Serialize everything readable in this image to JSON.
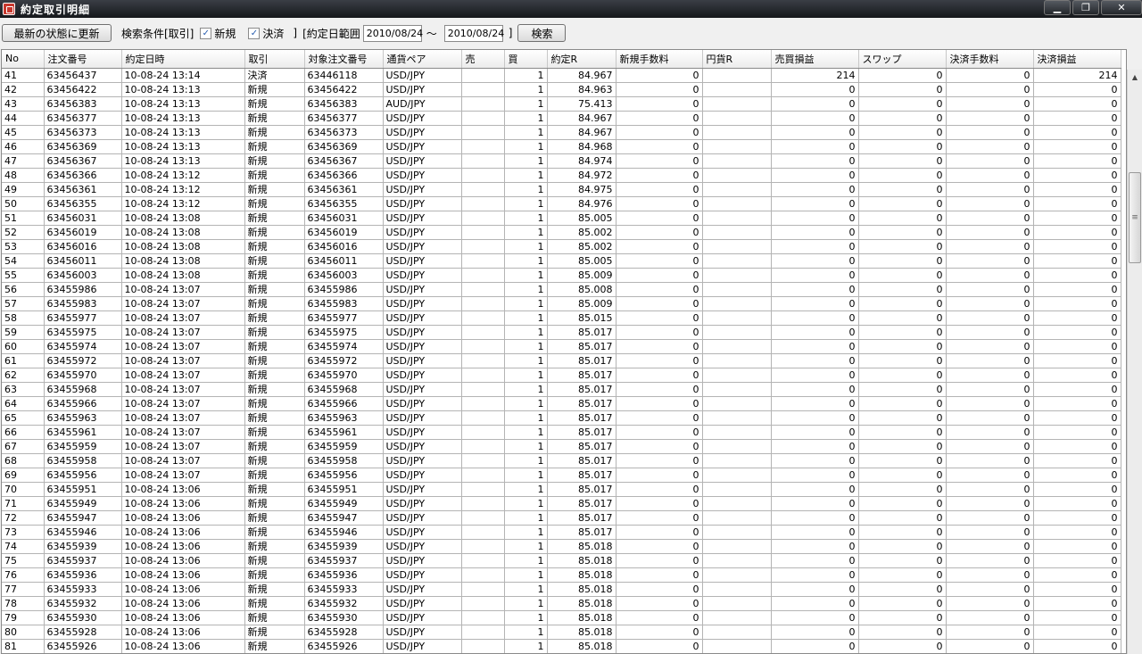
{
  "window": {
    "title": "約定取引明細",
    "min": "▁",
    "max": "❐",
    "close": "✕"
  },
  "toolbar": {
    "refresh_label": "最新の状態に更新",
    "criteria_label": "検索条件[取引]",
    "new_label": "新規",
    "new_checked": "✓",
    "settle_label": "決済",
    "settle_checked": "✓",
    "close_bracket": "]",
    "date_range_label": "[約定日範囲",
    "date_from": "2010/08/24",
    "tilde": "～",
    "date_to": "2010/08/24",
    "date_close": "]",
    "search_label": "検索"
  },
  "grid": {
    "columns": [
      "No",
      "注文番号",
      "約定日時",
      "取引",
      "対象注文番号",
      "通貨ペア",
      "売",
      "買",
      "約定R",
      "新規手数料",
      "円貨R",
      "売買損益",
      "スワップ",
      "決済手数料",
      "決済損益"
    ],
    "rows": [
      [
        "41",
        "63456437",
        "10-08-24 13:14",
        "決済",
        "63446118",
        "USD/JPY",
        "",
        "1",
        "84.967",
        "0",
        "",
        "214",
        "0",
        "0",
        "214"
      ],
      [
        "42",
        "63456422",
        "10-08-24 13:13",
        "新規",
        "63456422",
        "USD/JPY",
        "",
        "1",
        "84.963",
        "0",
        "",
        "0",
        "0",
        "0",
        "0"
      ],
      [
        "43",
        "63456383",
        "10-08-24 13:13",
        "新規",
        "63456383",
        "AUD/JPY",
        "",
        "1",
        "75.413",
        "0",
        "",
        "0",
        "0",
        "0",
        "0"
      ],
      [
        "44",
        "63456377",
        "10-08-24 13:13",
        "新規",
        "63456377",
        "USD/JPY",
        "",
        "1",
        "84.967",
        "0",
        "",
        "0",
        "0",
        "0",
        "0"
      ],
      [
        "45",
        "63456373",
        "10-08-24 13:13",
        "新規",
        "63456373",
        "USD/JPY",
        "",
        "1",
        "84.967",
        "0",
        "",
        "0",
        "0",
        "0",
        "0"
      ],
      [
        "46",
        "63456369",
        "10-08-24 13:13",
        "新規",
        "63456369",
        "USD/JPY",
        "",
        "1",
        "84.968",
        "0",
        "",
        "0",
        "0",
        "0",
        "0"
      ],
      [
        "47",
        "63456367",
        "10-08-24 13:13",
        "新規",
        "63456367",
        "USD/JPY",
        "",
        "1",
        "84.974",
        "0",
        "",
        "0",
        "0",
        "0",
        "0"
      ],
      [
        "48",
        "63456366",
        "10-08-24 13:12",
        "新規",
        "63456366",
        "USD/JPY",
        "",
        "1",
        "84.972",
        "0",
        "",
        "0",
        "0",
        "0",
        "0"
      ],
      [
        "49",
        "63456361",
        "10-08-24 13:12",
        "新規",
        "63456361",
        "USD/JPY",
        "",
        "1",
        "84.975",
        "0",
        "",
        "0",
        "0",
        "0",
        "0"
      ],
      [
        "50",
        "63456355",
        "10-08-24 13:12",
        "新規",
        "63456355",
        "USD/JPY",
        "",
        "1",
        "84.976",
        "0",
        "",
        "0",
        "0",
        "0",
        "0"
      ],
      [
        "51",
        "63456031",
        "10-08-24 13:08",
        "新規",
        "63456031",
        "USD/JPY",
        "",
        "1",
        "85.005",
        "0",
        "",
        "0",
        "0",
        "0",
        "0"
      ],
      [
        "52",
        "63456019",
        "10-08-24 13:08",
        "新規",
        "63456019",
        "USD/JPY",
        "",
        "1",
        "85.002",
        "0",
        "",
        "0",
        "0",
        "0",
        "0"
      ],
      [
        "53",
        "63456016",
        "10-08-24 13:08",
        "新規",
        "63456016",
        "USD/JPY",
        "",
        "1",
        "85.002",
        "0",
        "",
        "0",
        "0",
        "0",
        "0"
      ],
      [
        "54",
        "63456011",
        "10-08-24 13:08",
        "新規",
        "63456011",
        "USD/JPY",
        "",
        "1",
        "85.005",
        "0",
        "",
        "0",
        "0",
        "0",
        "0"
      ],
      [
        "55",
        "63456003",
        "10-08-24 13:08",
        "新規",
        "63456003",
        "USD/JPY",
        "",
        "1",
        "85.009",
        "0",
        "",
        "0",
        "0",
        "0",
        "0"
      ],
      [
        "56",
        "63455986",
        "10-08-24 13:07",
        "新規",
        "63455986",
        "USD/JPY",
        "",
        "1",
        "85.008",
        "0",
        "",
        "0",
        "0",
        "0",
        "0"
      ],
      [
        "57",
        "63455983",
        "10-08-24 13:07",
        "新規",
        "63455983",
        "USD/JPY",
        "",
        "1",
        "85.009",
        "0",
        "",
        "0",
        "0",
        "0",
        "0"
      ],
      [
        "58",
        "63455977",
        "10-08-24 13:07",
        "新規",
        "63455977",
        "USD/JPY",
        "",
        "1",
        "85.015",
        "0",
        "",
        "0",
        "0",
        "0",
        "0"
      ],
      [
        "59",
        "63455975",
        "10-08-24 13:07",
        "新規",
        "63455975",
        "USD/JPY",
        "",
        "1",
        "85.017",
        "0",
        "",
        "0",
        "0",
        "0",
        "0"
      ],
      [
        "60",
        "63455974",
        "10-08-24 13:07",
        "新規",
        "63455974",
        "USD/JPY",
        "",
        "1",
        "85.017",
        "0",
        "",
        "0",
        "0",
        "0",
        "0"
      ],
      [
        "61",
        "63455972",
        "10-08-24 13:07",
        "新規",
        "63455972",
        "USD/JPY",
        "",
        "1",
        "85.017",
        "0",
        "",
        "0",
        "0",
        "0",
        "0"
      ],
      [
        "62",
        "63455970",
        "10-08-24 13:07",
        "新規",
        "63455970",
        "USD/JPY",
        "",
        "1",
        "85.017",
        "0",
        "",
        "0",
        "0",
        "0",
        "0"
      ],
      [
        "63",
        "63455968",
        "10-08-24 13:07",
        "新規",
        "63455968",
        "USD/JPY",
        "",
        "1",
        "85.017",
        "0",
        "",
        "0",
        "0",
        "0",
        "0"
      ],
      [
        "64",
        "63455966",
        "10-08-24 13:07",
        "新規",
        "63455966",
        "USD/JPY",
        "",
        "1",
        "85.017",
        "0",
        "",
        "0",
        "0",
        "0",
        "0"
      ],
      [
        "65",
        "63455963",
        "10-08-24 13:07",
        "新規",
        "63455963",
        "USD/JPY",
        "",
        "1",
        "85.017",
        "0",
        "",
        "0",
        "0",
        "0",
        "0"
      ],
      [
        "66",
        "63455961",
        "10-08-24 13:07",
        "新規",
        "63455961",
        "USD/JPY",
        "",
        "1",
        "85.017",
        "0",
        "",
        "0",
        "0",
        "0",
        "0"
      ],
      [
        "67",
        "63455959",
        "10-08-24 13:07",
        "新規",
        "63455959",
        "USD/JPY",
        "",
        "1",
        "85.017",
        "0",
        "",
        "0",
        "0",
        "0",
        "0"
      ],
      [
        "68",
        "63455958",
        "10-08-24 13:07",
        "新規",
        "63455958",
        "USD/JPY",
        "",
        "1",
        "85.017",
        "0",
        "",
        "0",
        "0",
        "0",
        "0"
      ],
      [
        "69",
        "63455956",
        "10-08-24 13:07",
        "新規",
        "63455956",
        "USD/JPY",
        "",
        "1",
        "85.017",
        "0",
        "",
        "0",
        "0",
        "0",
        "0"
      ],
      [
        "70",
        "63455951",
        "10-08-24 13:06",
        "新規",
        "63455951",
        "USD/JPY",
        "",
        "1",
        "85.017",
        "0",
        "",
        "0",
        "0",
        "0",
        "0"
      ],
      [
        "71",
        "63455949",
        "10-08-24 13:06",
        "新規",
        "63455949",
        "USD/JPY",
        "",
        "1",
        "85.017",
        "0",
        "",
        "0",
        "0",
        "0",
        "0"
      ],
      [
        "72",
        "63455947",
        "10-08-24 13:06",
        "新規",
        "63455947",
        "USD/JPY",
        "",
        "1",
        "85.017",
        "0",
        "",
        "0",
        "0",
        "0",
        "0"
      ],
      [
        "73",
        "63455946",
        "10-08-24 13:06",
        "新規",
        "63455946",
        "USD/JPY",
        "",
        "1",
        "85.017",
        "0",
        "",
        "0",
        "0",
        "0",
        "0"
      ],
      [
        "74",
        "63455939",
        "10-08-24 13:06",
        "新規",
        "63455939",
        "USD/JPY",
        "",
        "1",
        "85.018",
        "0",
        "",
        "0",
        "0",
        "0",
        "0"
      ],
      [
        "75",
        "63455937",
        "10-08-24 13:06",
        "新規",
        "63455937",
        "USD/JPY",
        "",
        "1",
        "85.018",
        "0",
        "",
        "0",
        "0",
        "0",
        "0"
      ],
      [
        "76",
        "63455936",
        "10-08-24 13:06",
        "新規",
        "63455936",
        "USD/JPY",
        "",
        "1",
        "85.018",
        "0",
        "",
        "0",
        "0",
        "0",
        "0"
      ],
      [
        "77",
        "63455933",
        "10-08-24 13:06",
        "新規",
        "63455933",
        "USD/JPY",
        "",
        "1",
        "85.018",
        "0",
        "",
        "0",
        "0",
        "0",
        "0"
      ],
      [
        "78",
        "63455932",
        "10-08-24 13:06",
        "新規",
        "63455932",
        "USD/JPY",
        "",
        "1",
        "85.018",
        "0",
        "",
        "0",
        "0",
        "0",
        "0"
      ],
      [
        "79",
        "63455930",
        "10-08-24 13:06",
        "新規",
        "63455930",
        "USD/JPY",
        "",
        "1",
        "85.018",
        "0",
        "",
        "0",
        "0",
        "0",
        "0"
      ],
      [
        "80",
        "63455928",
        "10-08-24 13:06",
        "新規",
        "63455928",
        "USD/JPY",
        "",
        "1",
        "85.018",
        "0",
        "",
        "0",
        "0",
        "0",
        "0"
      ],
      [
        "81",
        "63455926",
        "10-08-24 13:06",
        "新規",
        "63455926",
        "USD/JPY",
        "",
        "1",
        "85.018",
        "0",
        "",
        "0",
        "0",
        "0",
        "0"
      ]
    ]
  },
  "scrollbar": {
    "up_icon": "▲",
    "grip": "≡"
  }
}
